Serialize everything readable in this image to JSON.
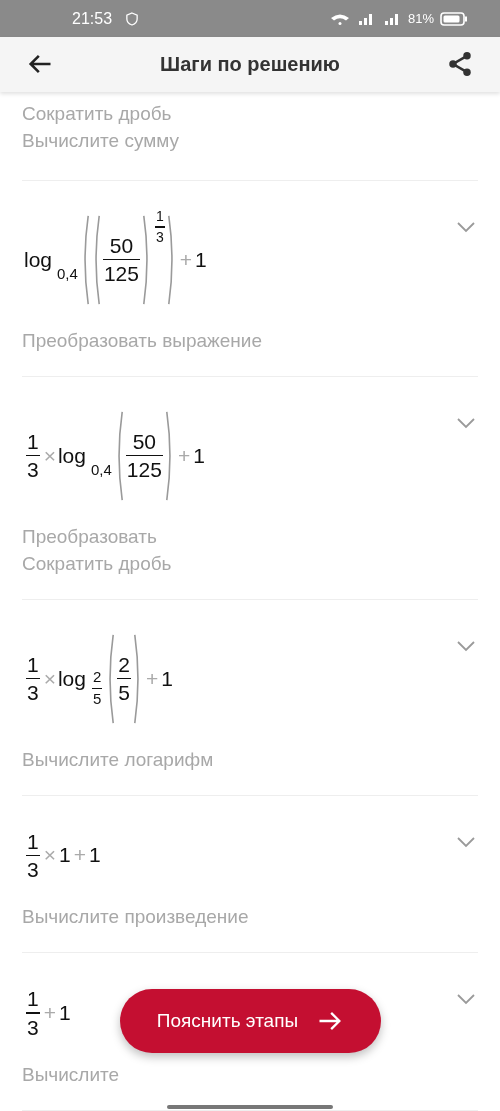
{
  "status_bar": {
    "time": "21:53",
    "battery": "81%"
  },
  "header": {
    "title": "Шаги по решению"
  },
  "steps": [
    {
      "descriptions": [
        "Сократить дробь",
        "Вычислите сумму"
      ]
    },
    {
      "expression": [
        {
          "kind": "log",
          "text": "log",
          "base": [
            {
              "kind": "num",
              "text": "0,4"
            }
          ]
        },
        {
          "kind": "paren",
          "children": [
            {
              "kind": "power",
              "base": [
                {
                  "kind": "paren",
                  "children": [
                    {
                      "kind": "frac",
                      "num": [
                        {
                          "kind": "num",
                          "text": "50"
                        }
                      ],
                      "den": [
                        {
                          "kind": "num",
                          "text": "125"
                        }
                      ]
                    }
                  ]
                }
              ],
              "exp": [
                {
                  "kind": "frac",
                  "num": [
                    {
                      "kind": "num",
                      "text": "1"
                    }
                  ],
                  "den": [
                    {
                      "kind": "num",
                      "text": "3"
                    }
                  ]
                }
              ]
            }
          ]
        },
        {
          "kind": "op",
          "text": "+"
        },
        {
          "kind": "num",
          "text": "1"
        }
      ],
      "descriptions": [
        "Преобразовать выражение"
      ],
      "expanded": false
    },
    {
      "expression": [
        {
          "kind": "frac",
          "num": [
            {
              "kind": "num",
              "text": "1"
            }
          ],
          "den": [
            {
              "kind": "num",
              "text": "3"
            }
          ]
        },
        {
          "kind": "op",
          "text": "×"
        },
        {
          "kind": "log",
          "text": "log",
          "base": [
            {
              "kind": "num",
              "text": "0,4"
            }
          ]
        },
        {
          "kind": "paren",
          "children": [
            {
              "kind": "frac",
              "num": [
                {
                  "kind": "num",
                  "text": "50"
                }
              ],
              "den": [
                {
                  "kind": "num",
                  "text": "125"
                }
              ]
            }
          ]
        },
        {
          "kind": "op",
          "text": "+"
        },
        {
          "kind": "num",
          "text": "1"
        }
      ],
      "descriptions": [
        "Преобразовать",
        "Сократить дробь"
      ],
      "expanded": false
    },
    {
      "expression": [
        {
          "kind": "frac",
          "num": [
            {
              "kind": "num",
              "text": "1"
            }
          ],
          "den": [
            {
              "kind": "num",
              "text": "3"
            }
          ]
        },
        {
          "kind": "op",
          "text": "×"
        },
        {
          "kind": "log",
          "text": "log",
          "base": [
            {
              "kind": "frac",
              "num": [
                {
                  "kind": "num",
                  "text": "2"
                }
              ],
              "den": [
                {
                  "kind": "num",
                  "text": "5"
                }
              ]
            }
          ]
        },
        {
          "kind": "paren",
          "children": [
            {
              "kind": "frac",
              "num": [
                {
                  "kind": "num",
                  "text": "2"
                }
              ],
              "den": [
                {
                  "kind": "num",
                  "text": "5"
                }
              ]
            }
          ]
        },
        {
          "kind": "op",
          "text": "+"
        },
        {
          "kind": "num",
          "text": "1"
        }
      ],
      "descriptions": [
        "Вычислите логарифм"
      ],
      "expanded": false
    },
    {
      "expression": [
        {
          "kind": "frac",
          "num": [
            {
              "kind": "num",
              "text": "1"
            }
          ],
          "den": [
            {
              "kind": "num",
              "text": "3"
            }
          ]
        },
        {
          "kind": "op",
          "text": "×"
        },
        {
          "kind": "num",
          "text": "1"
        },
        {
          "kind": "op",
          "text": "+"
        },
        {
          "kind": "num",
          "text": "1"
        }
      ],
      "descriptions": [
        "Вычислите произведение"
      ],
      "expanded": false
    },
    {
      "expression": [
        {
          "kind": "frac",
          "num": [
            {
              "kind": "num",
              "text": "1"
            }
          ],
          "den": [
            {
              "kind": "num",
              "text": "3"
            }
          ]
        },
        {
          "kind": "op",
          "text": "+"
        },
        {
          "kind": "num",
          "text": "1"
        }
      ],
      "descriptions": [
        "Вычислите"
      ],
      "expanded": false
    }
  ],
  "fab": {
    "label": "Пояснить этапы"
  }
}
